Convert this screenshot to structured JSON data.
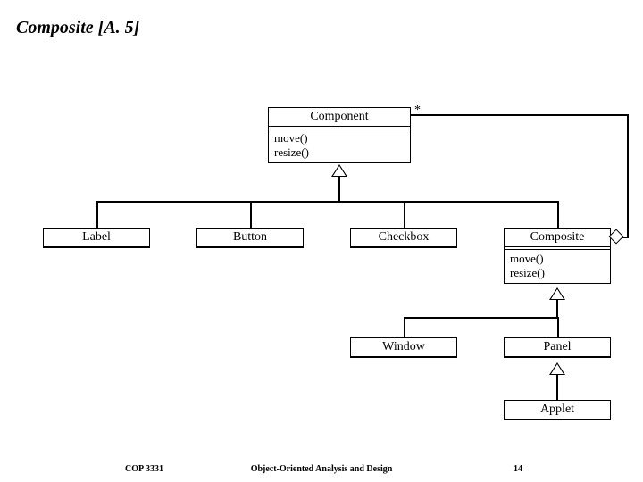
{
  "title": "Composite [A. 5]",
  "classes": {
    "component": {
      "name": "Component",
      "ops": [
        "move()",
        "resize()"
      ]
    },
    "label": {
      "name": "Label"
    },
    "button": {
      "name": "Button"
    },
    "checkbox": {
      "name": "Checkbox"
    },
    "composite": {
      "name": "Composite",
      "ops": [
        "move()",
        "resize()"
      ]
    },
    "window": {
      "name": "Window"
    },
    "panel": {
      "name": "Panel"
    },
    "applet": {
      "name": "Applet"
    }
  },
  "multiplicity": {
    "component_star": "*"
  },
  "footer": {
    "left": "COP 3331",
    "center": "Object-Oriented Analysis and Design",
    "right": "14"
  }
}
